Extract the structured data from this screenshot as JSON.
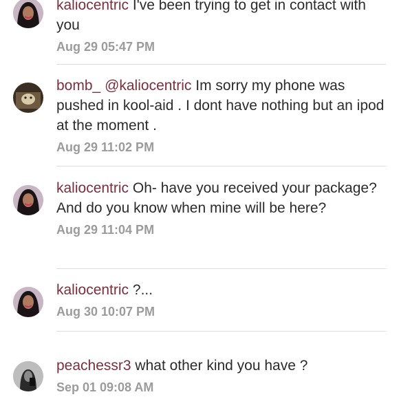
{
  "comments": [
    {
      "username": "kaliocentric",
      "mention": "",
      "text": "I've been trying to get in contact with you",
      "timestamp": "Aug 29 05:47 PM",
      "avatar_icon": "woman-portrait-avatar"
    },
    {
      "username": "bomb_",
      "mention": "@kaliocentric",
      "text": "Im sorry my phone was pushed in kool-aid . I dont have nothing but an ipod at the moment .",
      "timestamp": "Aug 29 11:02 PM",
      "avatar_icon": "dog-photo-avatar"
    },
    {
      "username": "kaliocentric",
      "mention": "",
      "text": "Oh- have you received your package? And do you know when mine will be here?",
      "timestamp": "Aug 29 11:04 PM",
      "avatar_icon": "woman-portrait-avatar"
    },
    {
      "username": "kaliocentric",
      "mention": "",
      "text": "?...",
      "timestamp": "Aug 30 10:07 PM",
      "avatar_icon": "woman-portrait-avatar"
    },
    {
      "username": "peachessr3",
      "mention": "",
      "text": "what other kind you have ?",
      "timestamp": "Sep 01 09:08 AM",
      "avatar_icon": "selfie-photo-avatar"
    }
  ],
  "colors": {
    "username": "#7a2f3d",
    "text": "#2b2b2b",
    "timestamp": "#9b9b9b",
    "divider": "#dcdcdc"
  }
}
